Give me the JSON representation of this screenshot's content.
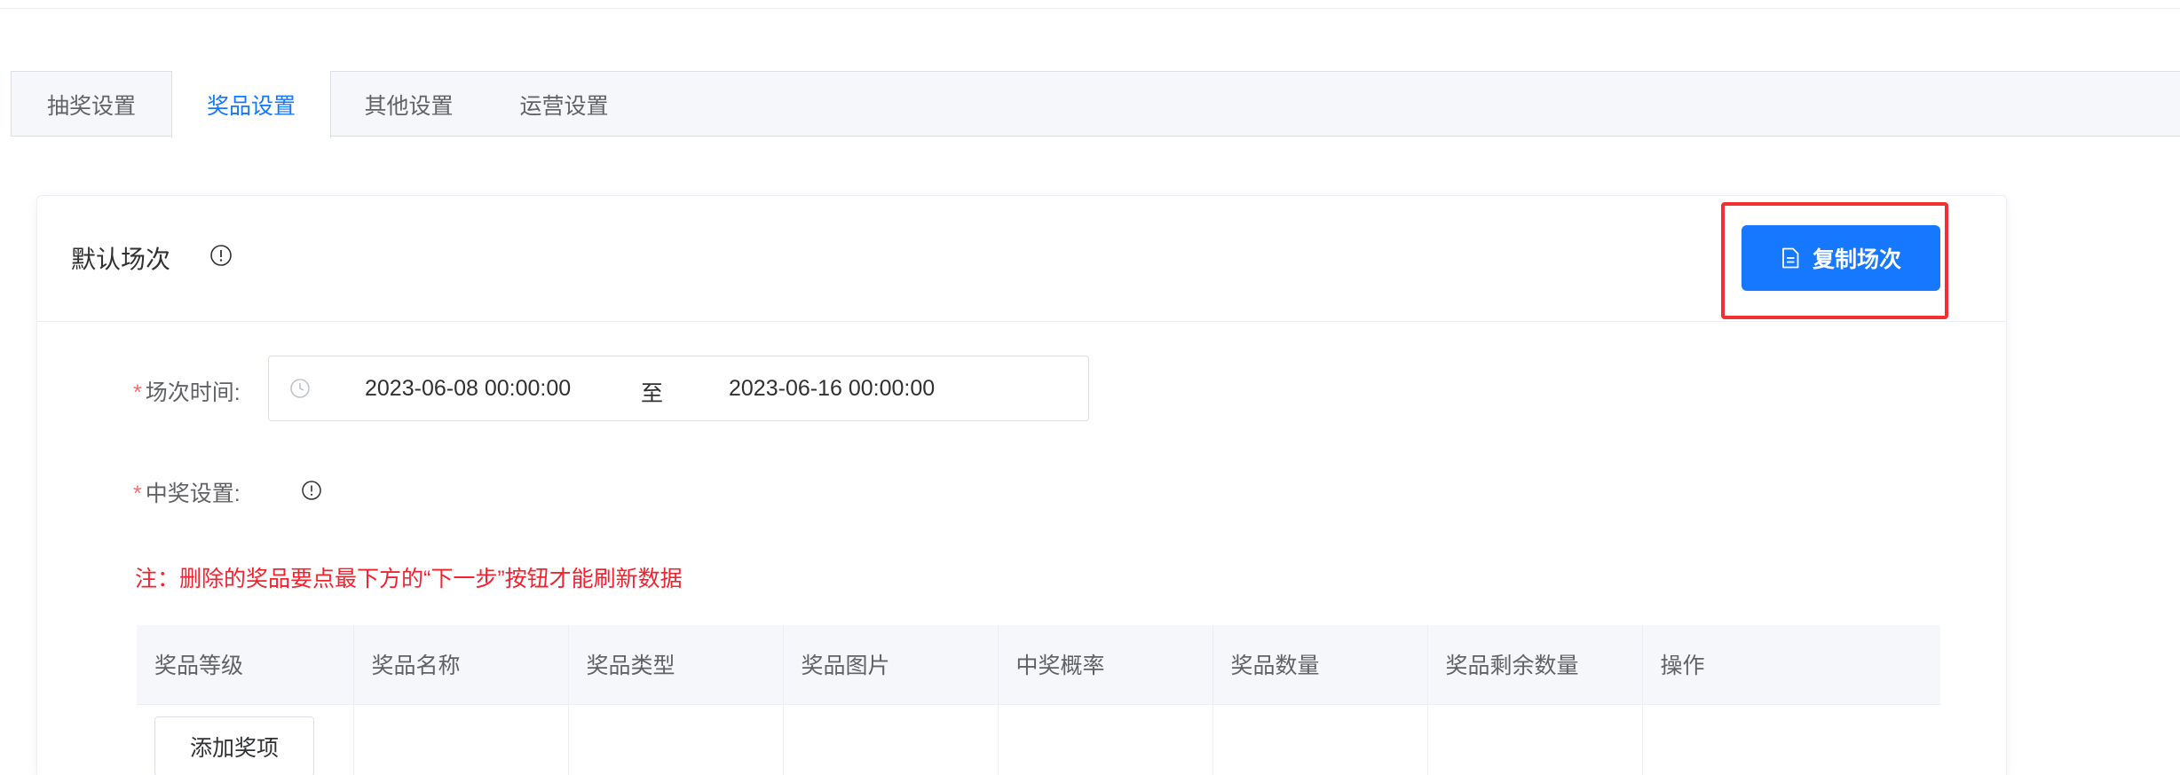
{
  "tabs": [
    "抽奖设置",
    "奖品设置",
    "其他设置",
    "运营设置"
  ],
  "active_tab": "奖品设置",
  "card": {
    "title": "默认场次",
    "copy_button": "复制场次"
  },
  "form": {
    "session_time_label": "场次时间:",
    "start_time": "2023-06-08 00:00:00",
    "range_separator": "至",
    "end_time": "2023-06-16 00:00:00",
    "prize_setting_label": "中奖设置:",
    "required_mark": "*"
  },
  "note": "注：删除的奖品要点最下方的“下一步”按钮才能刷新数据",
  "table": {
    "columns": [
      "奖品等级",
      "奖品名称",
      "奖品类型",
      "奖品图片",
      "中奖概率",
      "奖品数量",
      "奖品剩余数量",
      "操作"
    ],
    "add_button": "添加奖项"
  },
  "colors": {
    "primary": "#1677ff",
    "highlight_border": "#f23030",
    "note_red": "#f5222d"
  },
  "icons": {
    "info": "info-circle-icon",
    "copy": "document-icon",
    "clock": "clock-icon"
  }
}
